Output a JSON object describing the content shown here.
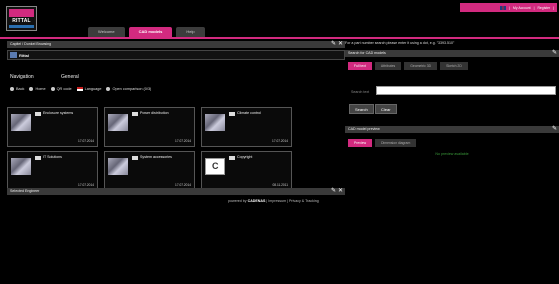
{
  "logo": {
    "text": "RITTAL"
  },
  "user_menu": {
    "items": [
      "My Account",
      "Register"
    ],
    "separator": "|"
  },
  "main_tabs": [
    {
      "label": "Welcome",
      "active": false
    },
    {
      "label": "CAD models",
      "active": true
    },
    {
      "label": "Help",
      "active": false
    }
  ],
  "left_panel": {
    "title": "Capitel / Dunkel Browsing",
    "view_label": "Rittal",
    "navigation_label": "Navigation",
    "general_label": "General",
    "nav_items": [
      "Back",
      "Home",
      "QR code",
      "Language",
      "Open comparison (0/3)"
    ],
    "cards": [
      {
        "title": "Enclosure systems",
        "date": "17.07.2014"
      },
      {
        "title": "Power distribution",
        "date": "17.07.2014"
      },
      {
        "title": "Climate control",
        "date": "17.07.2014"
      },
      {
        "title": "IT Solutions",
        "date": "17.07.2014"
      },
      {
        "title": "System accessories",
        "date": "17.07.2014"
      },
      {
        "title": "Copyright",
        "date": "08.11.2011"
      }
    ]
  },
  "lower_panel": {
    "title": "Selected Engineer"
  },
  "footer": {
    "powered": "powered by",
    "brand": "CADENAS",
    "links": "| Impressum | Privacy & Tracking"
  },
  "right": {
    "hint": "For a part number search please enter it using a dot, e.g. \"3393.510\"",
    "search_panel_title": "Search for CAD models",
    "search_tabs": [
      "Full text",
      "Attributes",
      "Geometric 3D",
      "Sketch 2D"
    ],
    "field_label": "Search text",
    "field_value": "",
    "search_button": "Search",
    "clear_button": "Clear",
    "preview_panel_title": "CAD model preview",
    "preview_tabs": [
      "Preview",
      "Dimension diagram"
    ],
    "no_preview": "No preview available"
  },
  "colors": {
    "accent": "#d22a7f",
    "panel": "#3a3a3a",
    "success_text": "#3a9a3a"
  }
}
